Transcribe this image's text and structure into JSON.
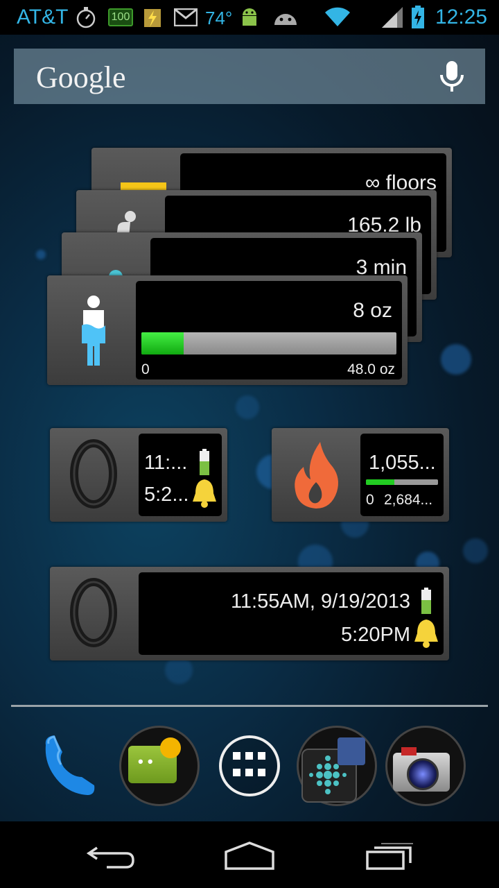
{
  "status_bar": {
    "carrier": "AT&T",
    "battery_badge": "100",
    "temperature": "74°",
    "time": "12:25",
    "icons": [
      "stopwatch-icon",
      "battery-100-icon",
      "flash-icon",
      "gmail-icon",
      "android-icon",
      "android-head-icon",
      "wifi-icon",
      "signal-icon",
      "battery-icon"
    ]
  },
  "search": {
    "logo": "Google",
    "voice_icon": "mic-icon"
  },
  "stack": {
    "floors": "∞ floors",
    "weight": "165.2 lb",
    "minutes": "3 min",
    "water": {
      "value": "8 oz",
      "min": "0",
      "max": "48.0 oz",
      "progress": 0.167
    }
  },
  "tracker_small": {
    "time": "11:...",
    "alarm": "5:2..."
  },
  "calories": {
    "value": "1,055...",
    "min": "0",
    "max": "2,684...",
    "progress": 0.39
  },
  "tracker_large": {
    "sync": "11:55AM, 9/19/2013",
    "alarm": "5:20PM"
  },
  "dock": [
    "phone-icon",
    "messaging-icon",
    "app-drawer-icon",
    "fitbit-icon",
    "camera-icon"
  ],
  "nav": [
    "back-icon",
    "home-icon",
    "recents-icon"
  ],
  "colors": {
    "accent": "#33b5e5",
    "progress": "#22cc22",
    "flame": "#f06a3a"
  }
}
